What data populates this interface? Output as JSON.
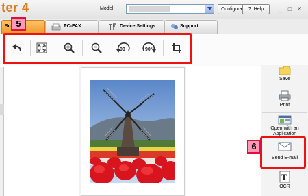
{
  "app": {
    "title": "ter 4"
  },
  "header": {
    "model_label": "Model",
    "config_label": "Configuration",
    "help_label": "Help",
    "help_mark": "?"
  },
  "window_controls": {
    "minimize": "_",
    "restore": "□",
    "close": "×"
  },
  "tabs": [
    {
      "label": "Sc",
      "icon": "scan-icon",
      "active": true
    },
    {
      "label": "PC-FAX",
      "icon": "fax-icon",
      "active": false
    },
    {
      "label": "Device Settings",
      "icon": "tools-icon",
      "active": false
    },
    {
      "label": "Support",
      "icon": "support-icon",
      "active": false
    }
  ],
  "toolbar": {
    "tools": [
      {
        "name": "undo-icon"
      },
      {
        "name": "fit-to-page-icon"
      },
      {
        "name": "zoom-in-icon"
      },
      {
        "name": "zoom-out-icon"
      },
      {
        "name": "rotate-left-90-icon",
        "label": "90"
      },
      {
        "name": "rotate-right-90-icon",
        "label": "90°"
      },
      {
        "name": "crop-icon"
      }
    ]
  },
  "annotations": {
    "step5": "5",
    "step6": "6"
  },
  "actions": [
    {
      "label": "Save",
      "icon": "folder-icon"
    },
    {
      "label": "Print",
      "icon": "printer-icon"
    },
    {
      "label": "Open with an Application",
      "icon": "application-icon"
    },
    {
      "label": "Send E-mail",
      "icon": "envelope-icon"
    },
    {
      "label": "OCR",
      "icon": "ocr-icon"
    }
  ],
  "colors": {
    "accent_orange": "#f09a2a",
    "highlight_red": "#ee1111",
    "badge_pink": "#ff99b8"
  }
}
